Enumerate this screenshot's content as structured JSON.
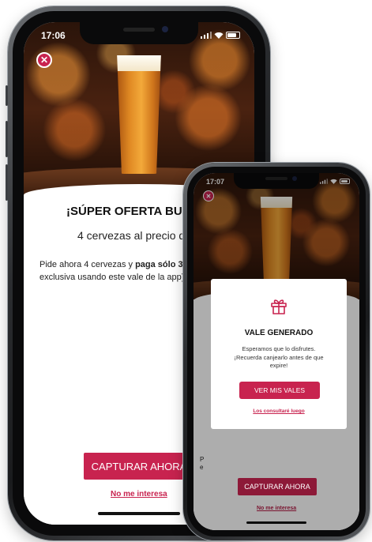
{
  "screen_a": {
    "time": "17:06",
    "title": "¡SÚPER OFERTA BUGGY",
    "subtitle": "4 cervezas al precio d",
    "body_line1_prefix": "Pide ahora 4 cervezas y ",
    "body_line1_bold": "paga sólo 3.",
    "body_line2": "exclusiva usando este vale de la app)",
    "cta_label": "CAPTURAR AHORA",
    "decline_link": "No me interesa"
  },
  "screen_b": {
    "time": "17:07",
    "peek_text": "P\ne",
    "cta_label": "CAPTURAR AHORA",
    "decline_link": "No me interesa",
    "modal": {
      "icon": "gift-icon",
      "title": "VALE GENERADO",
      "message_line1": "Esperamos que lo disfrutes.",
      "message_line2": "¡Recuerda canjearlo antes de que",
      "message_line3": "expire!",
      "primary_button": "VER MIS VALES",
      "secondary_link": "Los consultaré luego"
    }
  },
  "colors": {
    "accent": "#c8234f",
    "accent_dimmed": "#8d1938"
  }
}
